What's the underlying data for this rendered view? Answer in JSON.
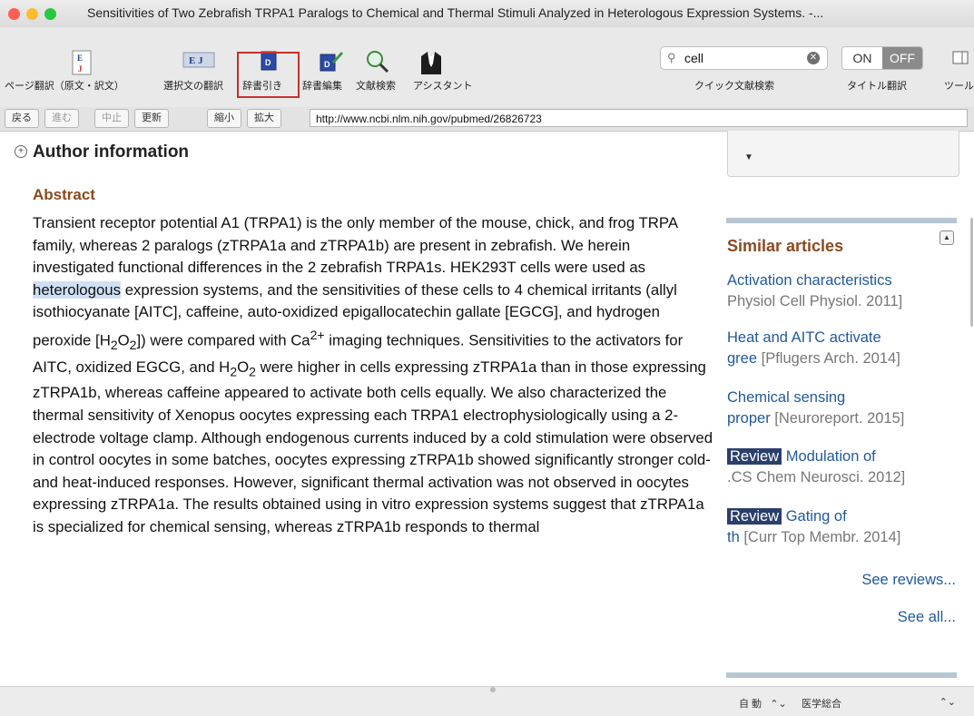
{
  "window": {
    "title": "Sensitivities of Two Zebrafish TRPA1 Paralogs to Chemical and Thermal Stimuli Analyzed in Heterologous Expression Systems. -..."
  },
  "toolbar": {
    "page_translate": "ページ翻訳（原文・訳文）",
    "selection_translate": "選択文の翻訳",
    "dictionary_lookup": "辞書引き",
    "dictionary_edit": "辞書編集",
    "literature_search": "文献検索",
    "assistant": "アシスタント",
    "quick_search": "クイック文献検索",
    "title_translate": "タイトル翻訳",
    "tools": "ツール",
    "search_value": "cell",
    "toggle_on": "ON",
    "toggle_off": "OFF",
    "ej_icon_text": "E J"
  },
  "nav": {
    "back": "戻る",
    "forward": "進む",
    "stop": "中止",
    "refresh": "更新",
    "zoom_out": "縮小",
    "zoom_in": "拡大",
    "url": "http://www.ncbi.nlm.nih.gov/pubmed/26826723"
  },
  "main": {
    "author_info": "Author information",
    "abstract_heading": "Abstract",
    "abstract_parts": {
      "p1": "Transient receptor potential A1 (TRPA1) is the only member of the mouse, chick, and frog TRPA family, whereas 2 paralogs (zTRPA1a and zTRPA1b) are present in zebrafish. We herein investigated functional differences in the 2 zebrafish TRPA1s. HEK293T cells were used as ",
      "highlight": "heterologous",
      "p2": " expression systems, and the sensitivities of these cells to 4 chemical irritants (allyl isothiocyanate [AITC], caffeine, auto-oxidized epigallocatechin gallate [EGCG], and hydrogen peroxide [H",
      "sub1": "2",
      "p3": "O",
      "sub2": "2",
      "p4": "]) were compared with Ca",
      "sup1": "2+",
      "p5": " imaging techniques. Sensitivities to the activators for AITC, oxidized EGCG, and H",
      "sub3": "2",
      "p6": "O",
      "sub4": "2",
      "p7": " were higher in cells expressing zTRPA1a than in those expressing zTRPA1b, whereas caffeine appeared to activate both cells equally. We also characterized the thermal sensitivity of Xenopus oocytes expressing each TRPA1 electrophysiologically using a 2-electrode voltage clamp. Although endogenous currents induced by a cold stimulation were observed in control oocytes in some batches, oocytes expressing zTRPA1b showed significantly stronger cold- and heat-induced responses. However, significant thermal activation was not observed in oocytes expressing zTRPA1a. The results obtained using in vitro expression systems suggest that zTRPA1a is specialized for chemical sensing, whereas zTRPA1b responds to thermal"
    }
  },
  "sidebar": {
    "similar_heading": "Similar articles",
    "articles": [
      {
        "line1": "Activation characteristics",
        "line2": "Physiol Cell Physiol. 2011]"
      },
      {
        "line1": "Heat and AITC activate",
        "line2": "gree",
        "line2b": " [Pflugers Arch. 2014]"
      },
      {
        "line1": "Chemical sensing",
        "line2": "proper",
        "line2b": " [Neuroreport. 2015]"
      },
      {
        "badge": "Review",
        "line1": " Modulation of",
        "line2": ".CS Chem Neurosci. 2012]"
      },
      {
        "badge": "Review",
        "line1": " Gating of",
        "line2": "th",
        "line2b": " [Curr Top Membr. 2014]"
      }
    ],
    "see_reviews": "See reviews...",
    "see_all": "See all..."
  },
  "status": {
    "mode": "自 動",
    "dictionary": "医学総合"
  }
}
